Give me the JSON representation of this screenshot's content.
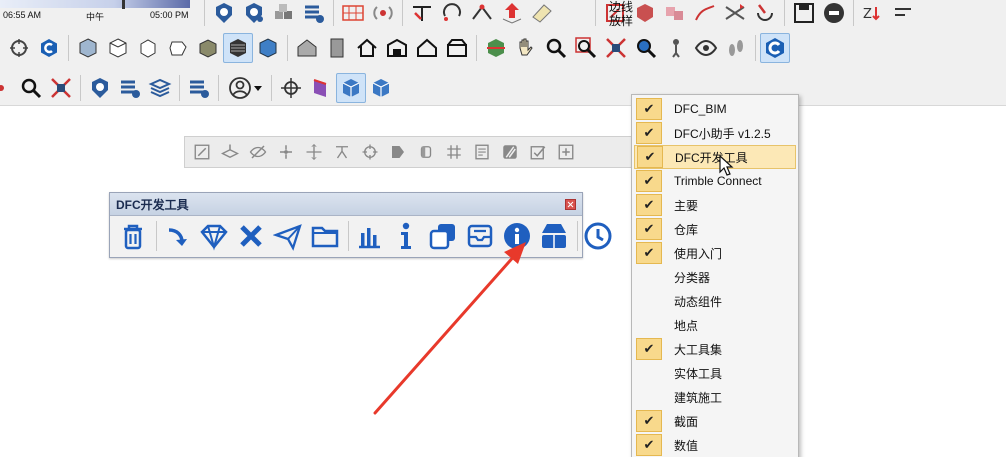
{
  "shadow_slider": {
    "start_time": "06:55 AM",
    "noon": "中午",
    "end_time": "05:00 PM",
    "position": 0.64
  },
  "edge_style": {
    "label_line1": "边线",
    "label_line2": "放样"
  },
  "dfc_palette": {
    "title": "DFC开发工具"
  },
  "toolbar_menu": {
    "items": [
      {
        "label": "DFC_BIM",
        "checked": true
      },
      {
        "label": "DFC小助手 v1.2.5",
        "checked": true
      },
      {
        "label": "DFC开发工具",
        "checked": true,
        "highlighted": true
      },
      {
        "label": "Trimble Connect",
        "checked": true
      },
      {
        "label": "主要",
        "checked": true
      },
      {
        "label": "仓库",
        "checked": true
      },
      {
        "label": "使用入门",
        "checked": true
      },
      {
        "label": "分类器",
        "checked": false
      },
      {
        "label": "动态组件",
        "checked": false
      },
      {
        "label": "地点",
        "checked": false
      },
      {
        "label": "大工具集",
        "checked": true
      },
      {
        "label": "实体工具",
        "checked": false
      },
      {
        "label": "建筑施工",
        "checked": false
      },
      {
        "label": "截面",
        "checked": true
      },
      {
        "label": "数值",
        "checked": true
      }
    ]
  },
  "colors": {
    "accent_blue": "#1f5fbf",
    "check_bg": "#f8d98c",
    "arrow_red": "#e8392b"
  }
}
